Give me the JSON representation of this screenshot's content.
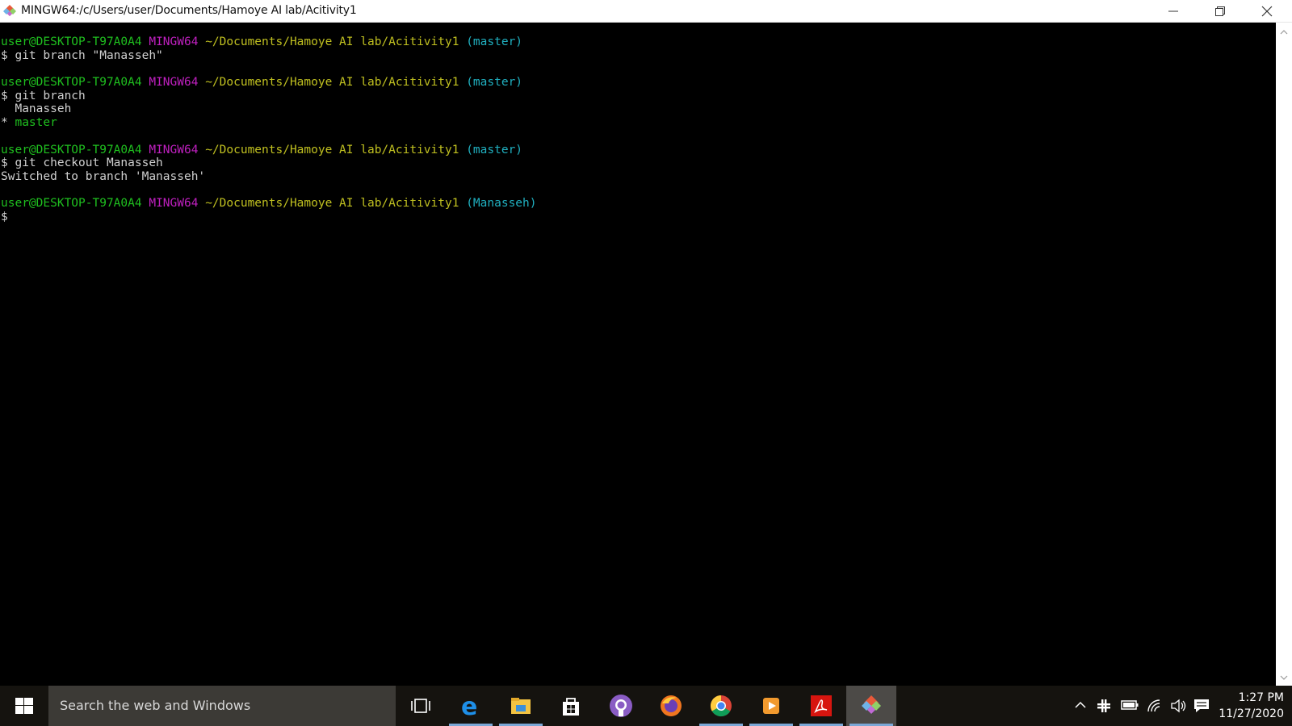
{
  "window": {
    "title": "MINGW64:/c/Users/user/Documents/Hamoye AI lab/Acitivity1"
  },
  "terminal": {
    "lines": [
      {
        "segs": [
          {
            "t": "user@DESKTOP-T97A0A4",
            "c": "green"
          },
          {
            "t": " "
          },
          {
            "t": "MINGW64",
            "c": "mag"
          },
          {
            "t": " "
          },
          {
            "t": "~/Documents/Hamoye AI lab/Acitivity1",
            "c": "yel"
          },
          {
            "t": " "
          },
          {
            "t": "(master)",
            "c": "cyan"
          }
        ]
      },
      {
        "segs": [
          {
            "t": "$ git branch \"Manasseh\"",
            "c": "white"
          }
        ]
      },
      {
        "segs": []
      },
      {
        "segs": [
          {
            "t": "user@DESKTOP-T97A0A4",
            "c": "green"
          },
          {
            "t": " "
          },
          {
            "t": "MINGW64",
            "c": "mag"
          },
          {
            "t": " "
          },
          {
            "t": "~/Documents/Hamoye AI lab/Acitivity1",
            "c": "yel"
          },
          {
            "t": " "
          },
          {
            "t": "(master)",
            "c": "cyan"
          }
        ]
      },
      {
        "segs": [
          {
            "t": "$ git branch",
            "c": "white"
          }
        ]
      },
      {
        "segs": [
          {
            "t": "  Manasseh",
            "c": "white"
          }
        ]
      },
      {
        "segs": [
          {
            "t": "* ",
            "c": "white"
          },
          {
            "t": "master",
            "c": "green"
          }
        ]
      },
      {
        "segs": []
      },
      {
        "segs": [
          {
            "t": "user@DESKTOP-T97A0A4",
            "c": "green"
          },
          {
            "t": " "
          },
          {
            "t": "MINGW64",
            "c": "mag"
          },
          {
            "t": " "
          },
          {
            "t": "~/Documents/Hamoye AI lab/Acitivity1",
            "c": "yel"
          },
          {
            "t": " "
          },
          {
            "t": "(master)",
            "c": "cyan"
          }
        ]
      },
      {
        "segs": [
          {
            "t": "$ git checkout Manasseh",
            "c": "white"
          }
        ]
      },
      {
        "segs": [
          {
            "t": "Switched to branch 'Manasseh'",
            "c": "white"
          }
        ]
      },
      {
        "segs": []
      },
      {
        "segs": [
          {
            "t": "user@DESKTOP-T97A0A4",
            "c": "green"
          },
          {
            "t": " "
          },
          {
            "t": "MINGW64",
            "c": "mag"
          },
          {
            "t": " "
          },
          {
            "t": "~/Documents/Hamoye AI lab/Acitivity1",
            "c": "yel"
          },
          {
            "t": " "
          },
          {
            "t": "(Manasseh)",
            "c": "cyan"
          }
        ]
      },
      {
        "segs": [
          {
            "t": "$",
            "c": "white"
          }
        ]
      }
    ]
  },
  "taskbar": {
    "search_placeholder": "Search the web and Windows",
    "apps": [
      {
        "name": "task-view-icon"
      },
      {
        "name": "edge-icon"
      },
      {
        "name": "file-explorer-icon"
      },
      {
        "name": "store-icon"
      },
      {
        "name": "github-icon"
      },
      {
        "name": "firefox-icon"
      },
      {
        "name": "chrome-icon"
      },
      {
        "name": "media-player-icon"
      },
      {
        "name": "acrobat-icon"
      },
      {
        "name": "git-bash-icon"
      }
    ],
    "clock": {
      "time": "1:27 PM",
      "date": "11/27/2020"
    }
  },
  "colors": {
    "green": "#1fc01f",
    "magenta": "#c020c0",
    "yellow": "#c0c020",
    "cyan": "#20b0c0",
    "taskbar": "#15130f"
  }
}
